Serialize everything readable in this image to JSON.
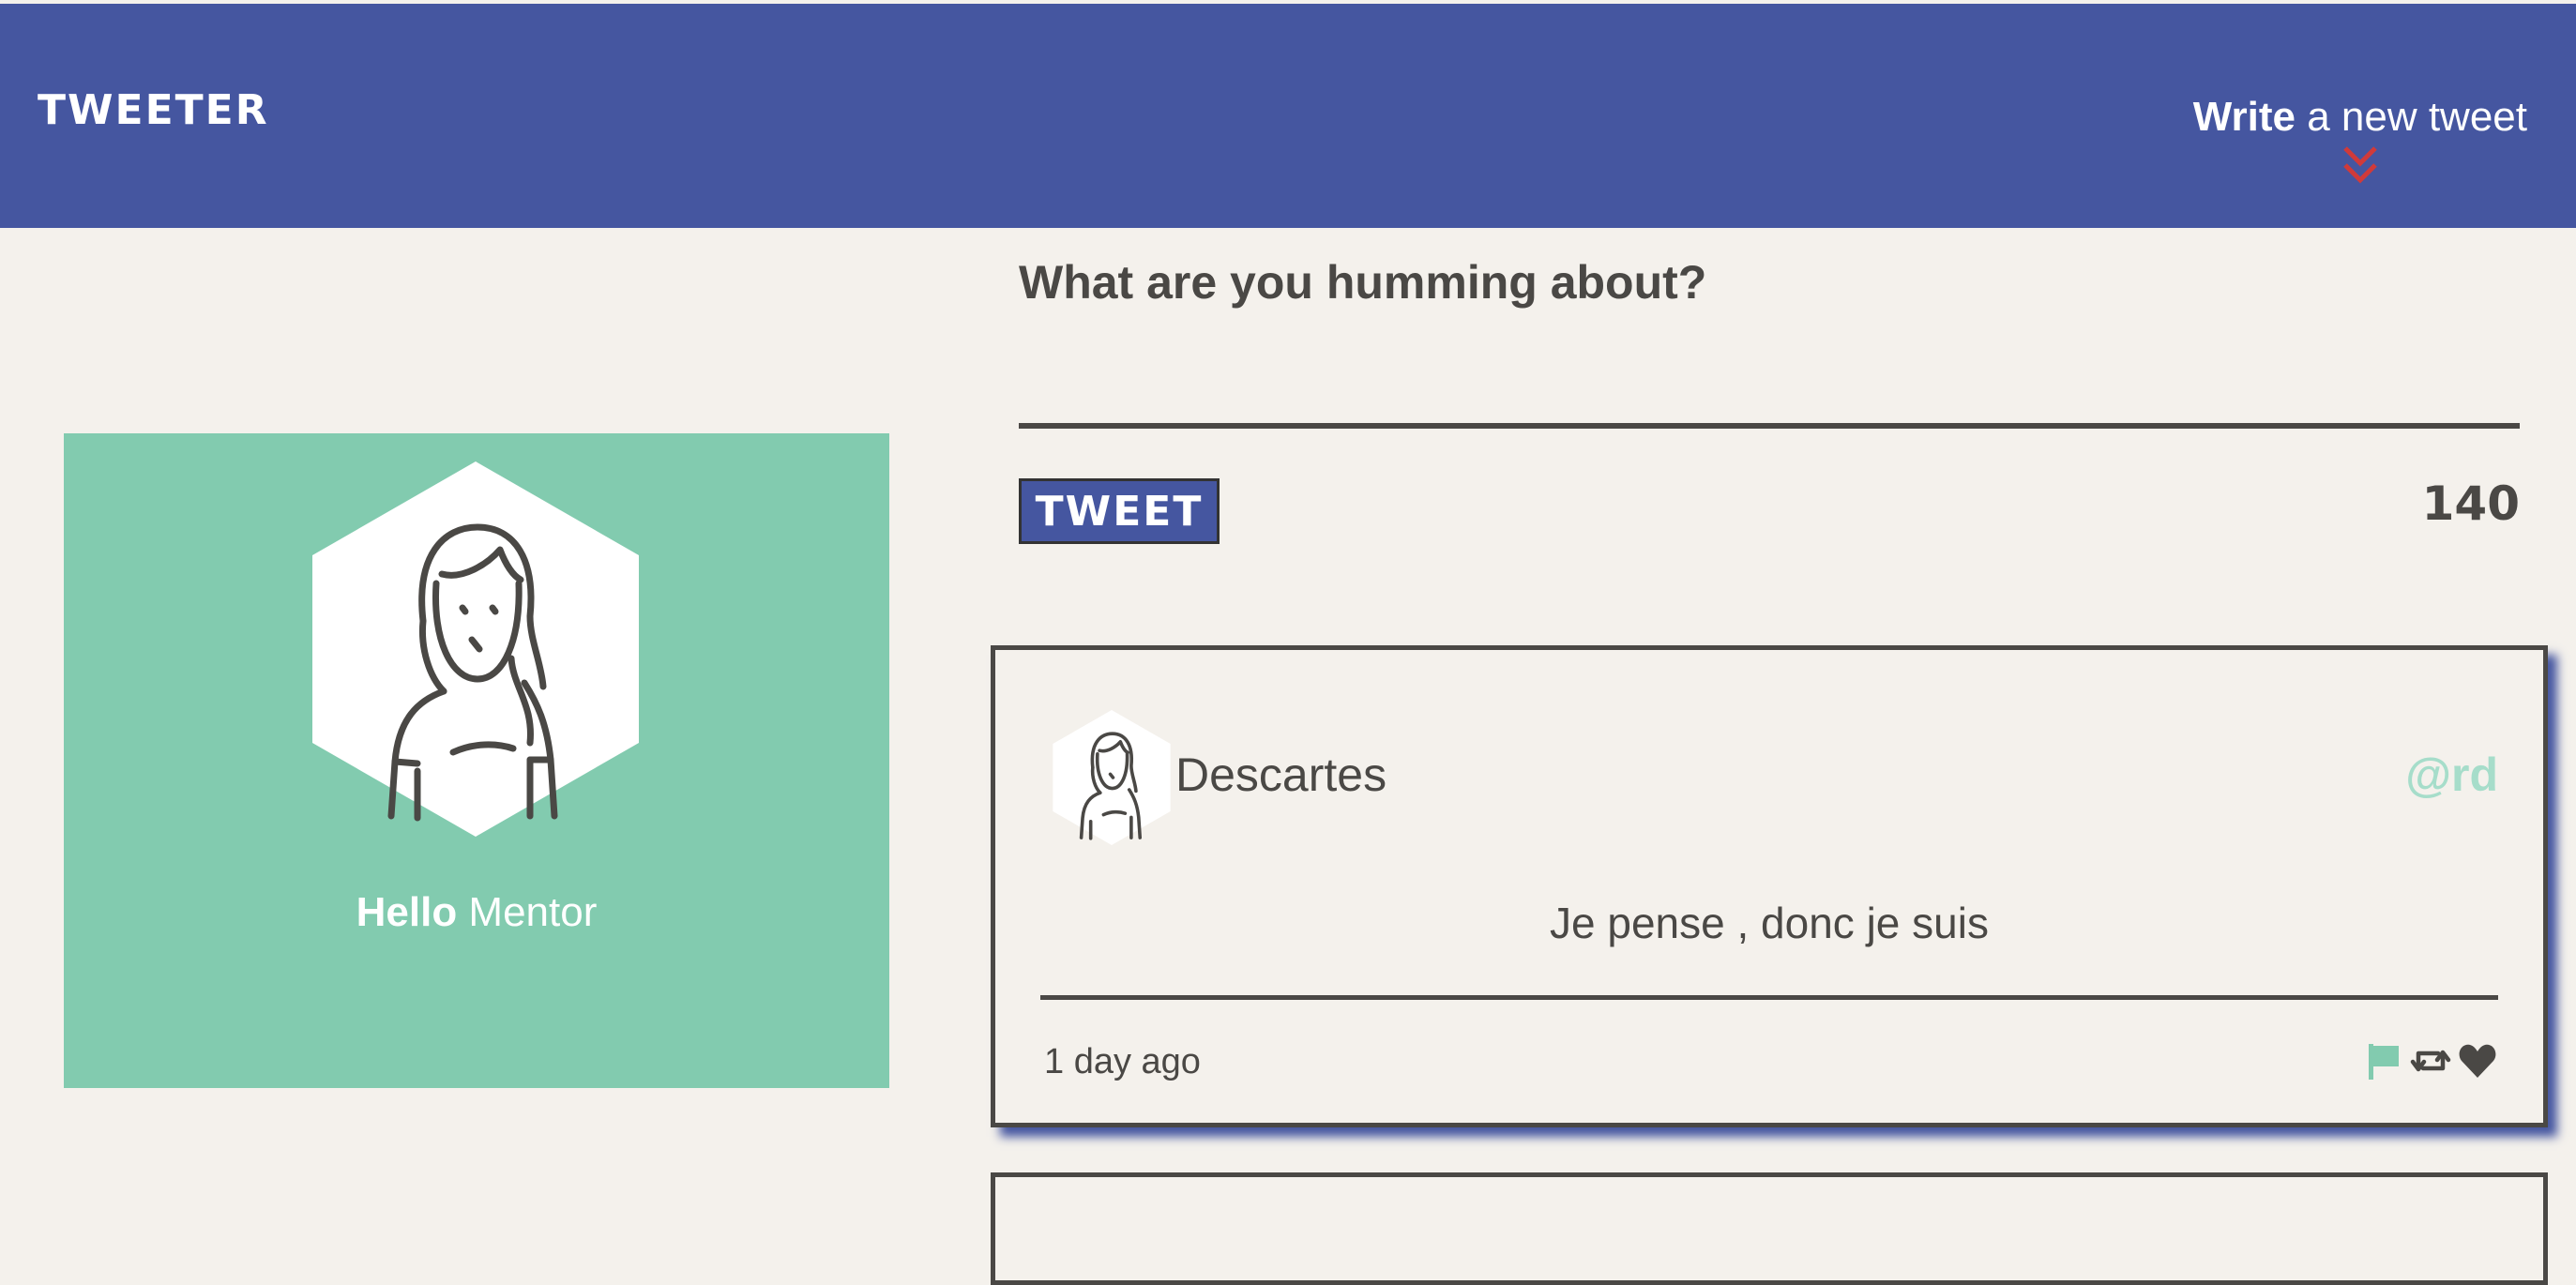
{
  "header": {
    "brand": "TWEETER",
    "compose_toggle": {
      "bold": "Write",
      "rest": " a new tweet"
    }
  },
  "profile": {
    "greeting_bold": "Hello",
    "greeting_name": " Mentor"
  },
  "composer": {
    "label": "What are you humming about?",
    "input_value": "",
    "button_label": "TWEET",
    "char_counter": "140"
  },
  "tweets": [
    {
      "name": "Descartes",
      "handle": "@rd",
      "content": "Je pense , donc je suis",
      "time": "1 day ago",
      "actions": [
        "flag-icon",
        "retweet-icon",
        "heart-icon"
      ]
    }
  ],
  "colors": {
    "nav": "#4556a0",
    "profile": "#82cbaf",
    "background": "#f4f1ec",
    "text": "#4a4845",
    "handle": "#a6ddca",
    "chevron": "#d03a3a"
  }
}
